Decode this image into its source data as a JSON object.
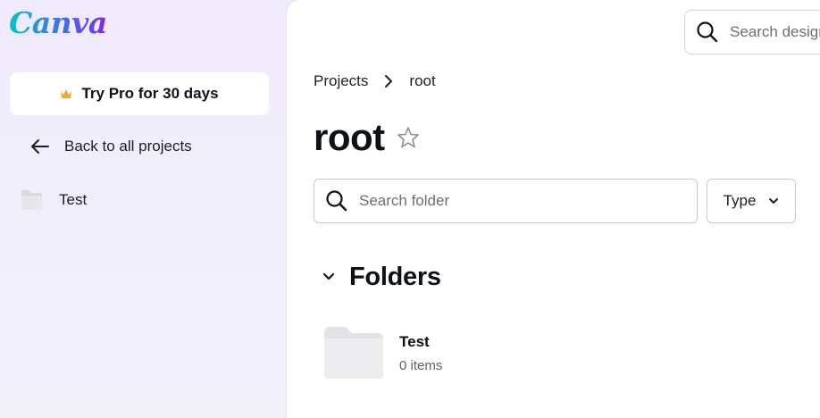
{
  "brand": {
    "logo_text": "Canva"
  },
  "sidebar": {
    "try_pro_label": "Try Pro for 30 days",
    "back_label": "Back to all projects",
    "folders": [
      {
        "label": "Test"
      }
    ]
  },
  "header": {
    "search_placeholder": "Search designs"
  },
  "breadcrumb": {
    "items": [
      "Projects",
      "root"
    ]
  },
  "page": {
    "title": "root"
  },
  "folder_search": {
    "placeholder": "Search folder",
    "value": ""
  },
  "filter": {
    "type_label": "Type"
  },
  "folders_section": {
    "heading": "Folders",
    "items": [
      {
        "name": "Test",
        "count": "0 items"
      }
    ]
  },
  "colors": {
    "crown": "#f4a833",
    "folder_gray": "#e8e8ec",
    "brand_gradient": [
      "#00c4cc",
      "#7d2ae8"
    ]
  },
  "icons": [
    "crown-icon",
    "arrow-left-icon",
    "folder-icon",
    "search-icon",
    "chevron-right-icon",
    "star-icon",
    "chevron-down-icon"
  ]
}
